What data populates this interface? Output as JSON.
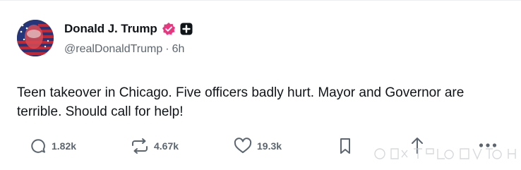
{
  "post": {
    "display_name": "Donald J. Trump",
    "handle": "@realDonaldTrump",
    "separator": "·",
    "time_ago": "6h",
    "text": "Teen takeover in Chicago. Five officers badly hurt. Mayor and Governor are terrible. Should call for help!"
  },
  "badges": {
    "verified_icon": "verified-badge-icon",
    "verified_color": "#e8377f",
    "plus_icon": "plus-badge-icon"
  },
  "actions": {
    "replies": "1.82k",
    "reposts": "4.67k",
    "likes": "19.3k"
  },
  "colors": {
    "text": "#0f1419",
    "muted": "#5b6670"
  }
}
